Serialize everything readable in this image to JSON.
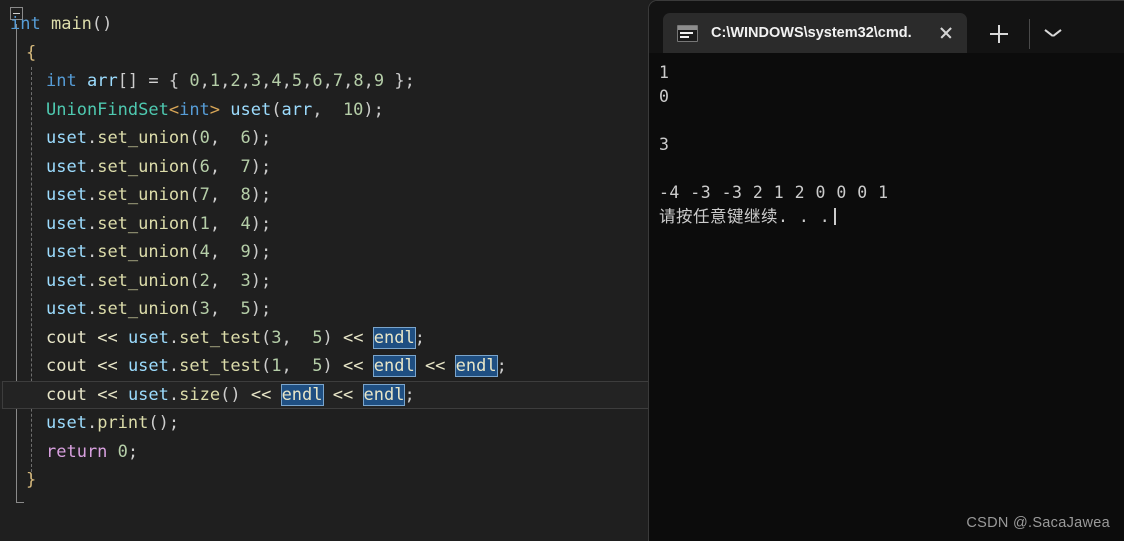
{
  "editor": {
    "name": "visual-studio-code-editor",
    "background": "#1f1f1f",
    "collapse_glyph": "-",
    "lines": [
      {
        "indent": 0,
        "current": false,
        "tokens": [
          {
            "t": "int",
            "c": "kw"
          },
          {
            "t": " ",
            "c": "op"
          },
          {
            "t": "main",
            "c": "fn"
          },
          {
            "t": "()",
            "c": "punc"
          }
        ]
      },
      {
        "indent": 1,
        "current": false,
        "tokens": [
          {
            "t": "{",
            "c": "brace1"
          }
        ]
      },
      {
        "indent": 2,
        "current": false,
        "tokens": [
          {
            "t": "int",
            "c": "kw"
          },
          {
            "t": " ",
            "c": "op"
          },
          {
            "t": "arr",
            "c": "var"
          },
          {
            "t": "[]",
            "c": "punc"
          },
          {
            "t": " = ",
            "c": "op"
          },
          {
            "t": "{ ",
            "c": "punc"
          },
          {
            "t": "0",
            "c": "num"
          },
          {
            "t": ",",
            "c": "punc"
          },
          {
            "t": "1",
            "c": "num"
          },
          {
            "t": ",",
            "c": "punc"
          },
          {
            "t": "2",
            "c": "num"
          },
          {
            "t": ",",
            "c": "punc"
          },
          {
            "t": "3",
            "c": "num"
          },
          {
            "t": ",",
            "c": "punc"
          },
          {
            "t": "4",
            "c": "num"
          },
          {
            "t": ",",
            "c": "punc"
          },
          {
            "t": "5",
            "c": "num"
          },
          {
            "t": ",",
            "c": "punc"
          },
          {
            "t": "6",
            "c": "num"
          },
          {
            "t": ",",
            "c": "punc"
          },
          {
            "t": "7",
            "c": "num"
          },
          {
            "t": ",",
            "c": "punc"
          },
          {
            "t": "8",
            "c": "num"
          },
          {
            "t": ",",
            "c": "punc"
          },
          {
            "t": "9",
            "c": "num"
          },
          {
            "t": " }",
            "c": "punc"
          },
          {
            "t": ";",
            "c": "punc"
          }
        ]
      },
      {
        "indent": 2,
        "current": false,
        "tokens": [
          {
            "t": "UnionFindSet",
            "c": "cls"
          },
          {
            "t": "<",
            "c": "angle"
          },
          {
            "t": "int",
            "c": "kw"
          },
          {
            "t": ">",
            "c": "angle"
          },
          {
            "t": " ",
            "c": "op"
          },
          {
            "t": "uset",
            "c": "var"
          },
          {
            "t": "(",
            "c": "punc"
          },
          {
            "t": "arr",
            "c": "var"
          },
          {
            "t": ",  ",
            "c": "punc"
          },
          {
            "t": "10",
            "c": "num"
          },
          {
            "t": ")",
            "c": "punc"
          },
          {
            "t": ";",
            "c": "punc"
          }
        ]
      },
      {
        "indent": 2,
        "current": false,
        "tokens": [
          {
            "t": "uset",
            "c": "var"
          },
          {
            "t": ".",
            "c": "punc"
          },
          {
            "t": "set_union",
            "c": "fn"
          },
          {
            "t": "(",
            "c": "punc"
          },
          {
            "t": "0",
            "c": "num"
          },
          {
            "t": ",  ",
            "c": "punc"
          },
          {
            "t": "6",
            "c": "num"
          },
          {
            "t": ")",
            "c": "punc"
          },
          {
            "t": ";",
            "c": "punc"
          }
        ]
      },
      {
        "indent": 2,
        "current": false,
        "tokens": [
          {
            "t": "uset",
            "c": "var"
          },
          {
            "t": ".",
            "c": "punc"
          },
          {
            "t": "set_union",
            "c": "fn"
          },
          {
            "t": "(",
            "c": "punc"
          },
          {
            "t": "6",
            "c": "num"
          },
          {
            "t": ",  ",
            "c": "punc"
          },
          {
            "t": "7",
            "c": "num"
          },
          {
            "t": ")",
            "c": "punc"
          },
          {
            "t": ";",
            "c": "punc"
          }
        ]
      },
      {
        "indent": 2,
        "current": false,
        "tokens": [
          {
            "t": "uset",
            "c": "var"
          },
          {
            "t": ".",
            "c": "punc"
          },
          {
            "t": "set_union",
            "c": "fn"
          },
          {
            "t": "(",
            "c": "punc"
          },
          {
            "t": "7",
            "c": "num"
          },
          {
            "t": ",  ",
            "c": "punc"
          },
          {
            "t": "8",
            "c": "num"
          },
          {
            "t": ")",
            "c": "punc"
          },
          {
            "t": ";",
            "c": "punc"
          }
        ]
      },
      {
        "indent": 2,
        "current": false,
        "tokens": [
          {
            "t": "uset",
            "c": "var"
          },
          {
            "t": ".",
            "c": "punc"
          },
          {
            "t": "set_union",
            "c": "fn"
          },
          {
            "t": "(",
            "c": "punc"
          },
          {
            "t": "1",
            "c": "num"
          },
          {
            "t": ",  ",
            "c": "punc"
          },
          {
            "t": "4",
            "c": "num"
          },
          {
            "t": ")",
            "c": "punc"
          },
          {
            "t": ";",
            "c": "punc"
          }
        ]
      },
      {
        "indent": 2,
        "current": false,
        "tokens": [
          {
            "t": "uset",
            "c": "var"
          },
          {
            "t": ".",
            "c": "punc"
          },
          {
            "t": "set_union",
            "c": "fn"
          },
          {
            "t": "(",
            "c": "punc"
          },
          {
            "t": "4",
            "c": "num"
          },
          {
            "t": ",  ",
            "c": "punc"
          },
          {
            "t": "9",
            "c": "num"
          },
          {
            "t": ")",
            "c": "punc"
          },
          {
            "t": ";",
            "c": "punc"
          }
        ]
      },
      {
        "indent": 2,
        "current": false,
        "tokens": [
          {
            "t": "uset",
            "c": "var"
          },
          {
            "t": ".",
            "c": "punc"
          },
          {
            "t": "set_union",
            "c": "fn"
          },
          {
            "t": "(",
            "c": "punc"
          },
          {
            "t": "2",
            "c": "num"
          },
          {
            "t": ",  ",
            "c": "punc"
          },
          {
            "t": "3",
            "c": "num"
          },
          {
            "t": ")",
            "c": "punc"
          },
          {
            "t": ";",
            "c": "punc"
          }
        ]
      },
      {
        "indent": 2,
        "current": false,
        "tokens": [
          {
            "t": "uset",
            "c": "var"
          },
          {
            "t": ".",
            "c": "punc"
          },
          {
            "t": "set_union",
            "c": "fn"
          },
          {
            "t": "(",
            "c": "punc"
          },
          {
            "t": "3",
            "c": "num"
          },
          {
            "t": ",  ",
            "c": "punc"
          },
          {
            "t": "5",
            "c": "num"
          },
          {
            "t": ")",
            "c": "punc"
          },
          {
            "t": ";",
            "c": "punc"
          }
        ]
      },
      {
        "indent": 2,
        "current": false,
        "tokens": [
          {
            "t": "cout",
            "c": "obj"
          },
          {
            "t": " ",
            "c": "op"
          },
          {
            "t": "<<",
            "c": "obj"
          },
          {
            "t": " ",
            "c": "op"
          },
          {
            "t": "uset",
            "c": "var"
          },
          {
            "t": ".",
            "c": "punc"
          },
          {
            "t": "set_test",
            "c": "fn"
          },
          {
            "t": "(",
            "c": "punc"
          },
          {
            "t": "3",
            "c": "num"
          },
          {
            "t": ",  ",
            "c": "punc"
          },
          {
            "t": "5",
            "c": "num"
          },
          {
            "t": ")",
            "c": "punc"
          },
          {
            "t": " ",
            "c": "op"
          },
          {
            "t": "<<",
            "c": "obj"
          },
          {
            "t": " ",
            "c": "op"
          },
          {
            "t": "endl",
            "c": "sel"
          },
          {
            "t": ";",
            "c": "punc"
          }
        ]
      },
      {
        "indent": 2,
        "current": false,
        "tokens": [
          {
            "t": "cout",
            "c": "obj"
          },
          {
            "t": " ",
            "c": "op"
          },
          {
            "t": "<<",
            "c": "obj"
          },
          {
            "t": " ",
            "c": "op"
          },
          {
            "t": "uset",
            "c": "var"
          },
          {
            "t": ".",
            "c": "punc"
          },
          {
            "t": "set_test",
            "c": "fn"
          },
          {
            "t": "(",
            "c": "punc"
          },
          {
            "t": "1",
            "c": "num"
          },
          {
            "t": ",  ",
            "c": "punc"
          },
          {
            "t": "5",
            "c": "num"
          },
          {
            "t": ")",
            "c": "punc"
          },
          {
            "t": " ",
            "c": "op"
          },
          {
            "t": "<<",
            "c": "obj"
          },
          {
            "t": " ",
            "c": "op"
          },
          {
            "t": "endl",
            "c": "sel"
          },
          {
            "t": " ",
            "c": "op"
          },
          {
            "t": "<<",
            "c": "obj"
          },
          {
            "t": " ",
            "c": "op"
          },
          {
            "t": "endl",
            "c": "sel"
          },
          {
            "t": ";",
            "c": "punc"
          }
        ]
      },
      {
        "indent": 2,
        "current": true,
        "tokens": [
          {
            "t": "cout",
            "c": "obj"
          },
          {
            "t": " ",
            "c": "op"
          },
          {
            "t": "<<",
            "c": "obj"
          },
          {
            "t": " ",
            "c": "op"
          },
          {
            "t": "uset",
            "c": "var"
          },
          {
            "t": ".",
            "c": "punc"
          },
          {
            "t": "size",
            "c": "fn"
          },
          {
            "t": "()",
            "c": "punc"
          },
          {
            "t": " ",
            "c": "op"
          },
          {
            "t": "<<",
            "c": "obj"
          },
          {
            "t": " ",
            "c": "op"
          },
          {
            "t": "endl",
            "c": "sel"
          },
          {
            "t": " ",
            "c": "op"
          },
          {
            "t": "<<",
            "c": "obj"
          },
          {
            "t": " ",
            "c": "op"
          },
          {
            "t": "endl",
            "c": "sel"
          },
          {
            "t": ";",
            "c": "punc"
          }
        ]
      },
      {
        "indent": 2,
        "current": false,
        "tokens": [
          {
            "t": "uset",
            "c": "var"
          },
          {
            "t": ".",
            "c": "punc"
          },
          {
            "t": "print",
            "c": "fn"
          },
          {
            "t": "()",
            "c": "punc"
          },
          {
            "t": ";",
            "c": "punc"
          }
        ]
      },
      {
        "indent": 2,
        "current": false,
        "tokens": [
          {
            "t": "return",
            "c": "kw2"
          },
          {
            "t": " ",
            "c": "op"
          },
          {
            "t": "0",
            "c": "num"
          },
          {
            "t": ";",
            "c": "punc"
          }
        ]
      },
      {
        "indent": 1,
        "current": false,
        "tokens": [
          {
            "t": "}",
            "c": "brace1"
          }
        ]
      }
    ]
  },
  "terminal": {
    "name": "windows-terminal",
    "background": "#0c0c0c",
    "tab": {
      "title": "C:\\WINDOWS\\system32\\cmd.",
      "icon": "cmd-console-icon",
      "close_label": "×"
    },
    "new_tab_label": "+",
    "dropdown_label": "⌄",
    "output_lines": [
      "1",
      "0",
      "",
      "3",
      "",
      "-4 -3 -3 2 1 2 0 0 0 1",
      "请按任意键继续. . ."
    ]
  },
  "watermark": "CSDN @.SacaJawea"
}
